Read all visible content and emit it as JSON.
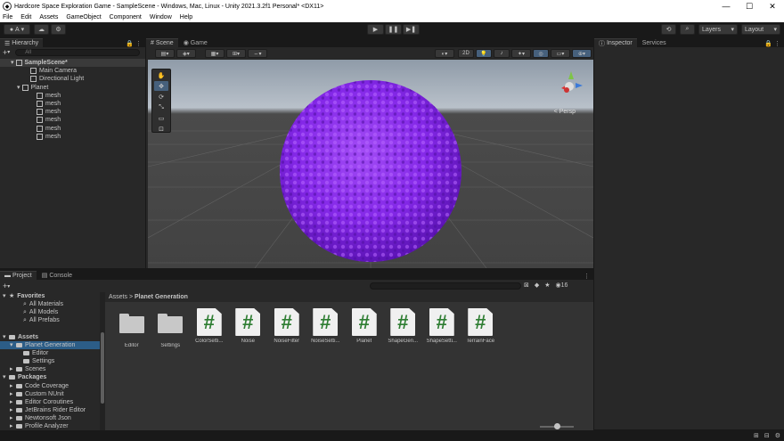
{
  "window": {
    "title": "Hardcore Space Exploration Game - SampleScene - Windows, Mac, Linux - Unity 2021.3.2f1 Personal* <DX11>",
    "minimize": "—",
    "maximize": "☐",
    "close": "✕"
  },
  "menu": [
    "File",
    "Edit",
    "Assets",
    "GameObject",
    "Component",
    "Window",
    "Help"
  ],
  "toolbar": {
    "account_label": "A",
    "play": "▶",
    "pause": "❚❚",
    "step": "▶❚",
    "history": "⟲",
    "search": "⌕",
    "layers_label": "Layers",
    "layout_label": "Layout"
  },
  "hierarchy": {
    "tab": "Hierarchy",
    "search_placeholder": "All",
    "add": "+",
    "rows": [
      {
        "label": "SampleScene*",
        "indent": 0,
        "kind": "scene"
      },
      {
        "label": "Main Camera",
        "indent": 2,
        "kind": "object"
      },
      {
        "label": "Directional Light",
        "indent": 2,
        "kind": "object"
      },
      {
        "label": "Planet",
        "indent": 1,
        "kind": "object"
      },
      {
        "label": "mesh",
        "indent": 3,
        "kind": "object"
      },
      {
        "label": "mesh",
        "indent": 3,
        "kind": "object"
      },
      {
        "label": "mesh",
        "indent": 3,
        "kind": "object"
      },
      {
        "label": "mesh",
        "indent": 3,
        "kind": "object"
      },
      {
        "label": "mesh",
        "indent": 3,
        "kind": "object"
      },
      {
        "label": "mesh",
        "indent": 3,
        "kind": "object"
      }
    ]
  },
  "scene": {
    "tabs": [
      "Scene",
      "Game"
    ],
    "toggle_2d": "2D",
    "persp_label": "< Persp",
    "sphere_color": "#8f2fef"
  },
  "inspector": {
    "tabs": [
      "Inspector",
      "Services"
    ]
  },
  "project": {
    "tabs": [
      "Project",
      "Console"
    ],
    "add": "+",
    "breadcrumb": [
      "Assets",
      "Planet Generation"
    ],
    "badge": "16",
    "tree": [
      {
        "label": "Favorites",
        "indent": 0,
        "kind": "header-star"
      },
      {
        "label": "All Materials",
        "indent": 2,
        "kind": "search"
      },
      {
        "label": "All Models",
        "indent": 2,
        "kind": "search"
      },
      {
        "label": "All Prefabs",
        "indent": 2,
        "kind": "search"
      },
      {
        "label": "",
        "indent": 0,
        "kind": "spacer"
      },
      {
        "label": "Assets",
        "indent": 0,
        "kind": "header-folder"
      },
      {
        "label": "Planet Generation",
        "indent": 1,
        "kind": "folder",
        "selected": true
      },
      {
        "label": "Editor",
        "indent": 2,
        "kind": "folder"
      },
      {
        "label": "Settings",
        "indent": 2,
        "kind": "folder"
      },
      {
        "label": "Scenes",
        "indent": 1,
        "kind": "folder"
      },
      {
        "label": "Packages",
        "indent": 0,
        "kind": "header-folder"
      },
      {
        "label": "Code Coverage",
        "indent": 1,
        "kind": "folder"
      },
      {
        "label": "Custom NUnit",
        "indent": 1,
        "kind": "folder"
      },
      {
        "label": "Editor Coroutines",
        "indent": 1,
        "kind": "folder"
      },
      {
        "label": "JetBrains Rider Editor",
        "indent": 1,
        "kind": "folder"
      },
      {
        "label": "Newtonsoft Json",
        "indent": 1,
        "kind": "folder"
      },
      {
        "label": "Profile Analyzer",
        "indent": 1,
        "kind": "folder"
      }
    ],
    "assets": [
      {
        "label": "Editor",
        "type": "folder"
      },
      {
        "label": "Settings",
        "type": "folder"
      },
      {
        "label": "ColorSetti...",
        "type": "script"
      },
      {
        "label": "Noise",
        "type": "script"
      },
      {
        "label": "NoiseFilter",
        "type": "script"
      },
      {
        "label": "NoiseSetti...",
        "type": "script"
      },
      {
        "label": "Planet",
        "type": "script"
      },
      {
        "label": "ShapeGen...",
        "type": "script"
      },
      {
        "label": "ShapeSetti...",
        "type": "script"
      },
      {
        "label": "TerrainFace",
        "type": "script"
      }
    ],
    "script_glyph": "#"
  }
}
